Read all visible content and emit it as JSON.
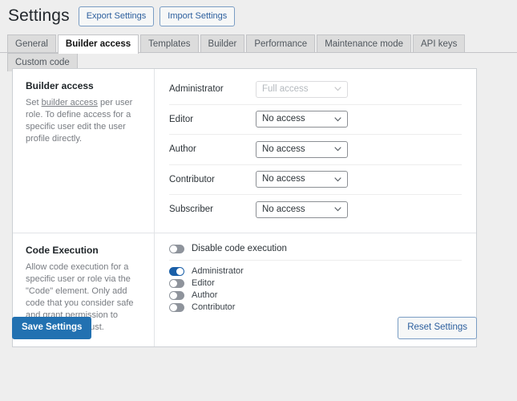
{
  "header": {
    "title": "Settings",
    "buttons": [
      {
        "label": "Export Settings",
        "name": "export-settings-button"
      },
      {
        "label": "Import Settings",
        "name": "import-settings-button"
      }
    ]
  },
  "tabs": [
    {
      "label": "General",
      "active": false
    },
    {
      "label": "Builder access",
      "active": true
    },
    {
      "label": "Templates",
      "active": false
    },
    {
      "label": "Builder",
      "active": false
    },
    {
      "label": "Performance",
      "active": false
    },
    {
      "label": "Maintenance mode",
      "active": false
    },
    {
      "label": "API keys",
      "active": false
    },
    {
      "label": "Custom code",
      "active": false
    }
  ],
  "sections": {
    "builder_access": {
      "title": "Builder access",
      "description_before": "Set ",
      "description_link": "builder access",
      "description_after": " per user role. To define access for a specific user edit the user profile directly.",
      "rows": [
        {
          "role": "Administrator",
          "value": "Full access",
          "disabled": true
        },
        {
          "role": "Editor",
          "value": "No access",
          "disabled": false
        },
        {
          "role": "Author",
          "value": "No access",
          "disabled": false
        },
        {
          "role": "Contributor",
          "value": "No access",
          "disabled": false
        },
        {
          "role": "Subscriber",
          "value": "No access",
          "disabled": false
        }
      ]
    },
    "code_execution": {
      "title": "Code Execution",
      "description": "Allow code execution for a specific user or role via the \"Code\" element. Only add code that you consider safe and grant permission to users you fully trust.",
      "disable_toggle": {
        "label": "Disable code execution",
        "on": false
      },
      "role_toggles": [
        {
          "label": "Administrator",
          "on": true
        },
        {
          "label": "Editor",
          "on": false
        },
        {
          "label": "Author",
          "on": false
        },
        {
          "label": "Contributor",
          "on": false
        }
      ]
    }
  },
  "footer": {
    "save_label": "Save Settings",
    "reset_label": "Reset Settings"
  },
  "colors": {
    "page_background": "#eeeeee",
    "card_background": "#ffffff",
    "accent_blue": "#2271b1",
    "toggle_on": "#1a5fa8",
    "toggle_off": "#8f949c",
    "link_blue": "#2c5f9e",
    "border": "#ccd0d4"
  }
}
